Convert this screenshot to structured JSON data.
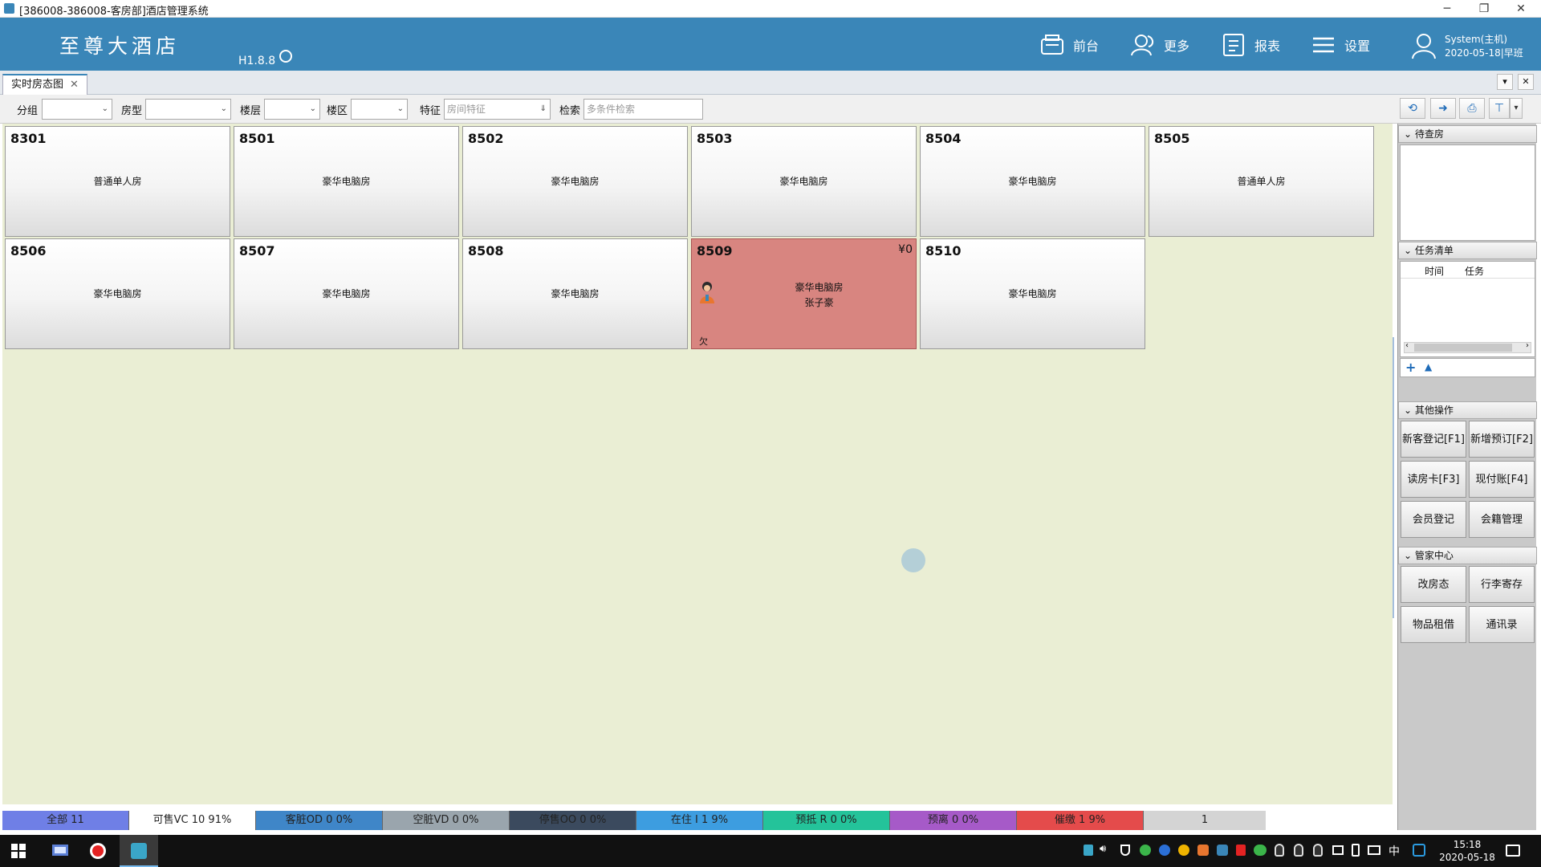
{
  "window": {
    "title": "[386008-386008-客房部]酒店管理系统",
    "controls": {
      "minimize": "─",
      "restore": "❐",
      "close": "✕"
    }
  },
  "header": {
    "logo": "至尊大酒店",
    "version": "H1.8.8",
    "nav": [
      {
        "label": "前台",
        "icon": "front-desk-icon"
      },
      {
        "label": "更多",
        "icon": "users-icon"
      },
      {
        "label": "报表",
        "icon": "report-icon"
      },
      {
        "label": "设置",
        "icon": "menu-icon"
      }
    ],
    "user": {
      "name": "System(主机)",
      "date_shift": "2020-05-18|早班"
    }
  },
  "tabs": [
    {
      "label": "实时房态图",
      "close": "✕"
    }
  ],
  "tab_controls": {
    "dropdown": "▾",
    "close": "✕"
  },
  "filters": {
    "group_label": "分组",
    "room_type_label": "房型",
    "floor_label": "楼层",
    "zone_label": "楼区",
    "feature_label": "特征",
    "feature_placeholder": "房间特征",
    "search_label": "检索",
    "search_placeholder": "多条件检索"
  },
  "rooms": [
    {
      "no": "8301",
      "type": "普通单人房"
    },
    {
      "no": "8501",
      "type": "豪华电脑房"
    },
    {
      "no": "8502",
      "type": "豪华电脑房"
    },
    {
      "no": "8503",
      "type": "豪华电脑房"
    },
    {
      "no": "8504",
      "type": "豪华电脑房"
    },
    {
      "no": "8505",
      "type": "普通单人房"
    },
    {
      "no": "8506",
      "type": "豪华电脑房"
    },
    {
      "no": "8507",
      "type": "豪华电脑房"
    },
    {
      "no": "8508",
      "type": "豪华电脑房"
    },
    {
      "no": "8509",
      "type": "豪华电脑房",
      "guest": "张子豪",
      "price": "¥0",
      "owe": "欠"
    },
    {
      "no": "8510",
      "type": "豪华电脑房"
    }
  ],
  "status": [
    {
      "label": "全部 11",
      "color": "#6f7fe6"
    },
    {
      "label": "可售VC 10 91%",
      "color": "#ffffff"
    },
    {
      "label": "客脏OD 0 0%",
      "color": "#3f86c8"
    },
    {
      "label": "空脏VD 0 0%",
      "color": "#9aa5ad"
    },
    {
      "label": "停售OO 0 0%",
      "color": "#3b4a5e"
    },
    {
      "label": "在住 I 1 9%",
      "color": "#3d9de0"
    },
    {
      "label": "预抵 R 0 0%",
      "color": "#24c39a"
    },
    {
      "label": "预离 0 0%",
      "color": "#a65ac8"
    },
    {
      "label": "催缴 1 9%",
      "color": "#e44b4b"
    },
    {
      "label": "1",
      "color": "#d4d4d4"
    }
  ],
  "panel": {
    "pending_title": "待查房",
    "tasks_title": "任务清单",
    "tasks_columns": [
      "时间",
      "任务"
    ],
    "other_title": "其他操作",
    "other_ops": [
      "新客登记[F1]",
      "新增预订[F2]",
      "读房卡[F3]",
      "现付账[F4]",
      "会员登记",
      "会籍管理"
    ],
    "butler_title": "管家中心",
    "butler_ops": [
      "改房态",
      "行李寄存",
      "物品租借",
      "通讯录"
    ]
  },
  "taskbar": {
    "time": "15:18",
    "date": "2020-05-18",
    "ime": "中"
  }
}
